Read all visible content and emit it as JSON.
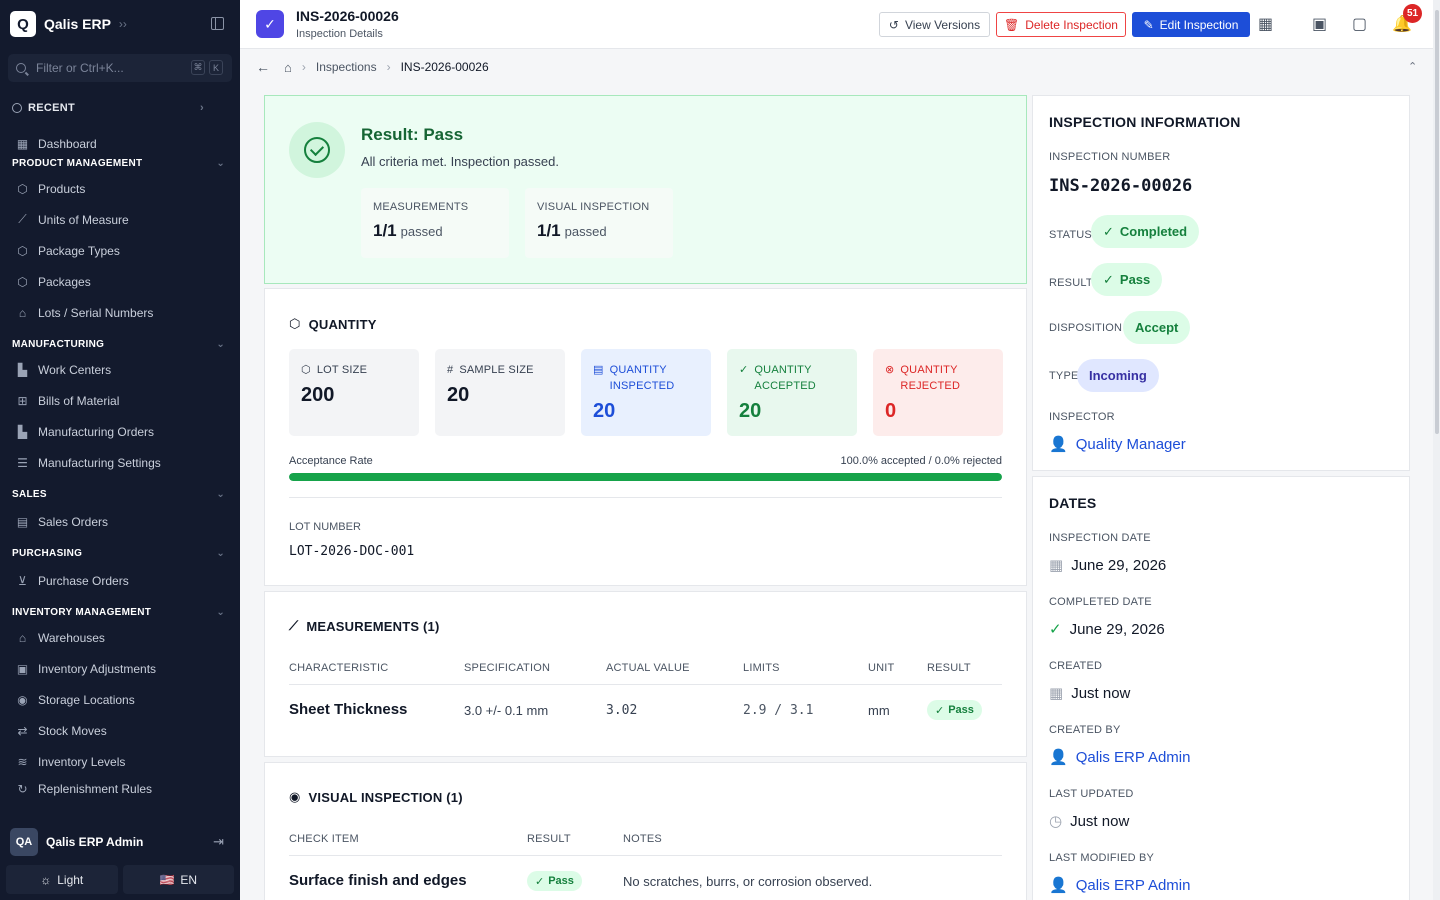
{
  "sidebar": {
    "app_name": "Qalis ERP",
    "logo_letter": "Q",
    "search_placeholder": "Filter or Ctrl+K...",
    "kbd1": "⌘",
    "kbd2": "K",
    "recent": "RECENT",
    "dashboard": "Dashboard",
    "sections": {
      "product": "PRODUCT MANAGEMENT",
      "manufacturing": "MANUFACTURING",
      "sales": "SALES",
      "purchasing": "PURCHASING",
      "inventory": "INVENTORY MANAGEMENT"
    },
    "product_items": [
      "Products",
      "Units of Measure",
      "Package Types",
      "Packages",
      "Lots / Serial Numbers"
    ],
    "manufacturing_items": [
      "Work Centers",
      "Bills of Material",
      "Manufacturing Orders",
      "Manufacturing Settings"
    ],
    "sales_items": [
      "Sales Orders"
    ],
    "purchasing_items": [
      "Purchase Orders"
    ],
    "inventory_items": [
      "Warehouses",
      "Inventory Adjustments",
      "Storage Locations",
      "Stock Moves",
      "Inventory Levels",
      "Replenishment Rules"
    ],
    "user_initials": "QA",
    "user_name": "Qalis ERP Admin",
    "theme_label": "Light",
    "lang_flag": "🇺🇸",
    "lang_label": "EN"
  },
  "header": {
    "title": "INS-2026-00026",
    "subtitle": "Inspection Details",
    "view_versions": "View Versions",
    "delete": "Delete Inspection",
    "edit": "Edit Inspection",
    "notif_count": "51"
  },
  "breadcrumb": {
    "inspections": "Inspections",
    "current": "INS-2026-00026"
  },
  "result": {
    "title": "Result: Pass",
    "desc": "All criteria met. Inspection passed.",
    "measurements_label": "MEASUREMENTS",
    "measurements_val": "1/1",
    "visual_label": "VISUAL INSPECTION",
    "visual_val": "1/1",
    "passed": "passed"
  },
  "quantity": {
    "title": "QUANTITY",
    "lot_size_label": "LOT SIZE",
    "lot_size": "200",
    "sample_size_label": "SAMPLE SIZE",
    "sample_size": "20",
    "inspected_label": "QUANTITY INSPECTED",
    "inspected": "20",
    "accepted_label": "QUANTITY ACCEPTED",
    "accepted": "20",
    "rejected_label": "QUANTITY REJECTED",
    "rejected": "0",
    "rate_label": "Acceptance Rate",
    "rate_text": "100.0% accepted / 0.0% rejected",
    "acceptance_fraction": 1.0,
    "lot_number_label": "LOT NUMBER",
    "lot_number": "LOT-2026-DOC-001"
  },
  "measurements": {
    "title": "MEASUREMENTS (1)",
    "headers": [
      "CHARACTERISTIC",
      "SPECIFICATION",
      "ACTUAL VALUE",
      "LIMITS",
      "UNIT",
      "RESULT"
    ],
    "row": {
      "characteristic": "Sheet Thickness",
      "specification": "3.0 +/- 0.1 mm",
      "actual": "3.02",
      "limits": "2.9 / 3.1",
      "unit": "mm",
      "result": "Pass"
    }
  },
  "visual": {
    "title": "VISUAL INSPECTION (1)",
    "headers": [
      "CHECK ITEM",
      "RESULT",
      "NOTES"
    ],
    "row": {
      "item": "Surface finish and edges",
      "result": "Pass",
      "notes": "No scratches, burrs, or corrosion observed."
    }
  },
  "info": {
    "title": "INSPECTION INFORMATION",
    "number_label": "INSPECTION NUMBER",
    "number": "INS-2026-00026",
    "status_label": "STATUS",
    "status": "Completed",
    "result_label": "RESULT",
    "result": "Pass",
    "disposition_label": "DISPOSITION",
    "disposition": "Accept",
    "type_label": "TYPE",
    "type": "Incoming",
    "inspector_label": "INSPECTOR",
    "inspector": "Quality Manager"
  },
  "dates": {
    "title": "DATES",
    "inspection_date_label": "INSPECTION DATE",
    "inspection_date": "June 29, 2026",
    "completed_date_label": "COMPLETED DATE",
    "completed_date": "June 29, 2026",
    "created_label": "CREATED",
    "created": "Just now",
    "created_by_label": "CREATED BY",
    "created_by": "Qalis ERP Admin",
    "updated_label": "LAST UPDATED",
    "updated": "Just now",
    "modified_by_label": "LAST MODIFIED BY",
    "modified_by": "Qalis ERP Admin"
  }
}
